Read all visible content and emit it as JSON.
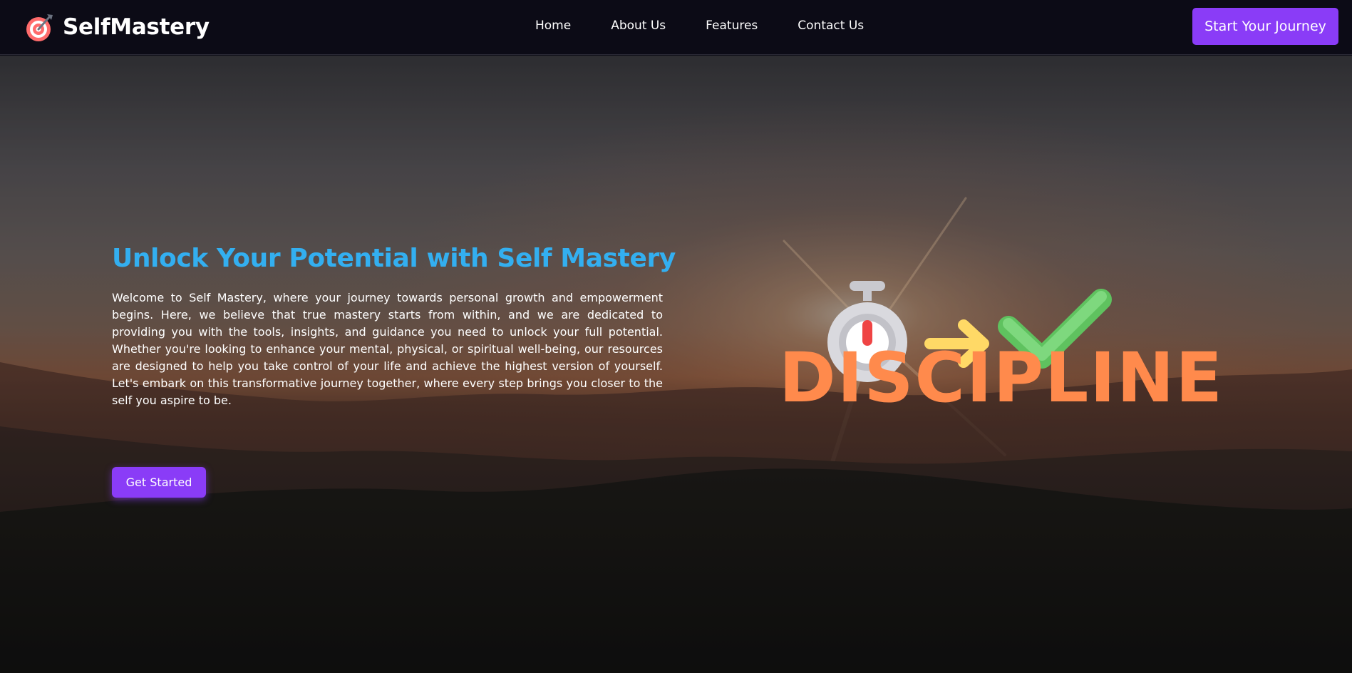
{
  "brand": {
    "name": "SelfMastery",
    "icon": "target-dart-icon",
    "icon_colors": {
      "ring": "#ff6b6b",
      "inner": "#ffffff",
      "dart": "#6b7280"
    }
  },
  "nav": {
    "items": [
      {
        "label": "Home"
      },
      {
        "label": "About Us"
      },
      {
        "label": "Features"
      },
      {
        "label": "Contact Us"
      }
    ],
    "cta_label": "Start Your Journey"
  },
  "hero": {
    "title": "Unlock Your Potential with Self Mastery",
    "body": "Welcome to Self Mastery, where your journey towards personal growth and empowerment begins. Here, we believe that true mastery starts from within, and we are dedicated to providing you with the tools, insights, and guidance you need to unlock your full potential. Whether you're looking to enhance your mental, physical, or spiritual well-being, our resources are designed to help you take control of your life and achieve the highest version of yourself. Let's embark on this transformative journey together, where every step brings you closer to the self you aspire to be.",
    "button_label": "Get Started",
    "background": "sunset-over-mountains-image"
  },
  "illustration": {
    "word": "DISCIPLINE",
    "icons": [
      "stopwatch-icon",
      "arrow-right-icon",
      "checkmark-icon"
    ]
  },
  "colors": {
    "navbar_bg": "#0c0b16",
    "accent_purple": "#8a3cf7",
    "title_blue": "#33aff0",
    "discipline_orange": "#ff8a4c",
    "arrow_yellow": "#ffd966",
    "check_green": "#6fd16f",
    "stopwatch_red": "#ef4444"
  }
}
